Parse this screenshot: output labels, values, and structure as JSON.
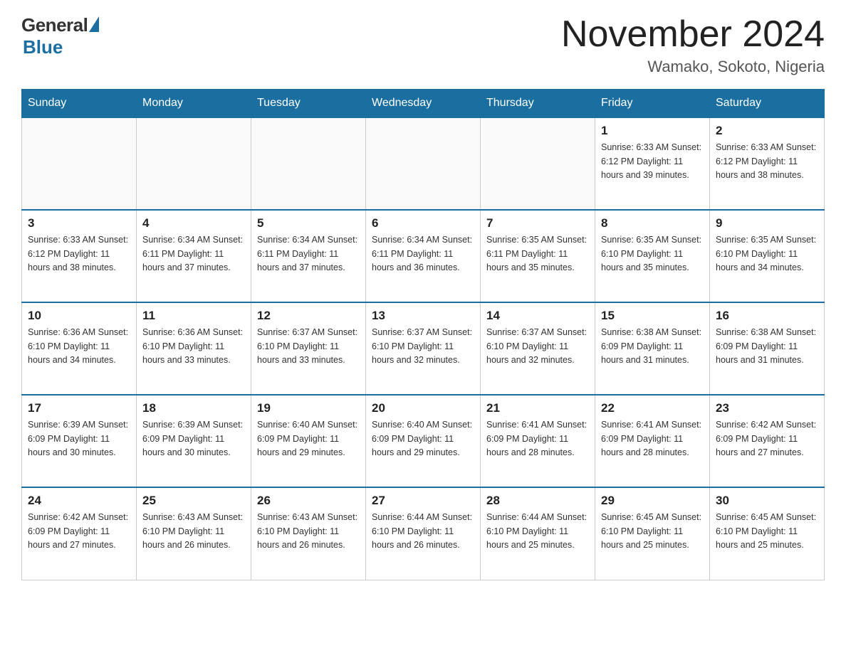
{
  "header": {
    "logo_general": "General",
    "logo_blue": "Blue",
    "main_title": "November 2024",
    "subtitle": "Wamako, Sokoto, Nigeria"
  },
  "days_of_week": [
    "Sunday",
    "Monday",
    "Tuesday",
    "Wednesday",
    "Thursday",
    "Friday",
    "Saturday"
  ],
  "weeks": [
    {
      "days": [
        {
          "num": "",
          "info": ""
        },
        {
          "num": "",
          "info": ""
        },
        {
          "num": "",
          "info": ""
        },
        {
          "num": "",
          "info": ""
        },
        {
          "num": "",
          "info": ""
        },
        {
          "num": "1",
          "info": "Sunrise: 6:33 AM\nSunset: 6:12 PM\nDaylight: 11 hours\nand 39 minutes."
        },
        {
          "num": "2",
          "info": "Sunrise: 6:33 AM\nSunset: 6:12 PM\nDaylight: 11 hours\nand 38 minutes."
        }
      ]
    },
    {
      "days": [
        {
          "num": "3",
          "info": "Sunrise: 6:33 AM\nSunset: 6:12 PM\nDaylight: 11 hours\nand 38 minutes."
        },
        {
          "num": "4",
          "info": "Sunrise: 6:34 AM\nSunset: 6:11 PM\nDaylight: 11 hours\nand 37 minutes."
        },
        {
          "num": "5",
          "info": "Sunrise: 6:34 AM\nSunset: 6:11 PM\nDaylight: 11 hours\nand 37 minutes."
        },
        {
          "num": "6",
          "info": "Sunrise: 6:34 AM\nSunset: 6:11 PM\nDaylight: 11 hours\nand 36 minutes."
        },
        {
          "num": "7",
          "info": "Sunrise: 6:35 AM\nSunset: 6:11 PM\nDaylight: 11 hours\nand 35 minutes."
        },
        {
          "num": "8",
          "info": "Sunrise: 6:35 AM\nSunset: 6:10 PM\nDaylight: 11 hours\nand 35 minutes."
        },
        {
          "num": "9",
          "info": "Sunrise: 6:35 AM\nSunset: 6:10 PM\nDaylight: 11 hours\nand 34 minutes."
        }
      ]
    },
    {
      "days": [
        {
          "num": "10",
          "info": "Sunrise: 6:36 AM\nSunset: 6:10 PM\nDaylight: 11 hours\nand 34 minutes."
        },
        {
          "num": "11",
          "info": "Sunrise: 6:36 AM\nSunset: 6:10 PM\nDaylight: 11 hours\nand 33 minutes."
        },
        {
          "num": "12",
          "info": "Sunrise: 6:37 AM\nSunset: 6:10 PM\nDaylight: 11 hours\nand 33 minutes."
        },
        {
          "num": "13",
          "info": "Sunrise: 6:37 AM\nSunset: 6:10 PM\nDaylight: 11 hours\nand 32 minutes."
        },
        {
          "num": "14",
          "info": "Sunrise: 6:37 AM\nSunset: 6:10 PM\nDaylight: 11 hours\nand 32 minutes."
        },
        {
          "num": "15",
          "info": "Sunrise: 6:38 AM\nSunset: 6:09 PM\nDaylight: 11 hours\nand 31 minutes."
        },
        {
          "num": "16",
          "info": "Sunrise: 6:38 AM\nSunset: 6:09 PM\nDaylight: 11 hours\nand 31 minutes."
        }
      ]
    },
    {
      "days": [
        {
          "num": "17",
          "info": "Sunrise: 6:39 AM\nSunset: 6:09 PM\nDaylight: 11 hours\nand 30 minutes."
        },
        {
          "num": "18",
          "info": "Sunrise: 6:39 AM\nSunset: 6:09 PM\nDaylight: 11 hours\nand 30 minutes."
        },
        {
          "num": "19",
          "info": "Sunrise: 6:40 AM\nSunset: 6:09 PM\nDaylight: 11 hours\nand 29 minutes."
        },
        {
          "num": "20",
          "info": "Sunrise: 6:40 AM\nSunset: 6:09 PM\nDaylight: 11 hours\nand 29 minutes."
        },
        {
          "num": "21",
          "info": "Sunrise: 6:41 AM\nSunset: 6:09 PM\nDaylight: 11 hours\nand 28 minutes."
        },
        {
          "num": "22",
          "info": "Sunrise: 6:41 AM\nSunset: 6:09 PM\nDaylight: 11 hours\nand 28 minutes."
        },
        {
          "num": "23",
          "info": "Sunrise: 6:42 AM\nSunset: 6:09 PM\nDaylight: 11 hours\nand 27 minutes."
        }
      ]
    },
    {
      "days": [
        {
          "num": "24",
          "info": "Sunrise: 6:42 AM\nSunset: 6:09 PM\nDaylight: 11 hours\nand 27 minutes."
        },
        {
          "num": "25",
          "info": "Sunrise: 6:43 AM\nSunset: 6:10 PM\nDaylight: 11 hours\nand 26 minutes."
        },
        {
          "num": "26",
          "info": "Sunrise: 6:43 AM\nSunset: 6:10 PM\nDaylight: 11 hours\nand 26 minutes."
        },
        {
          "num": "27",
          "info": "Sunrise: 6:44 AM\nSunset: 6:10 PM\nDaylight: 11 hours\nand 26 minutes."
        },
        {
          "num": "28",
          "info": "Sunrise: 6:44 AM\nSunset: 6:10 PM\nDaylight: 11 hours\nand 25 minutes."
        },
        {
          "num": "29",
          "info": "Sunrise: 6:45 AM\nSunset: 6:10 PM\nDaylight: 11 hours\nand 25 minutes."
        },
        {
          "num": "30",
          "info": "Sunrise: 6:45 AM\nSunset: 6:10 PM\nDaylight: 11 hours\nand 25 minutes."
        }
      ]
    }
  ]
}
